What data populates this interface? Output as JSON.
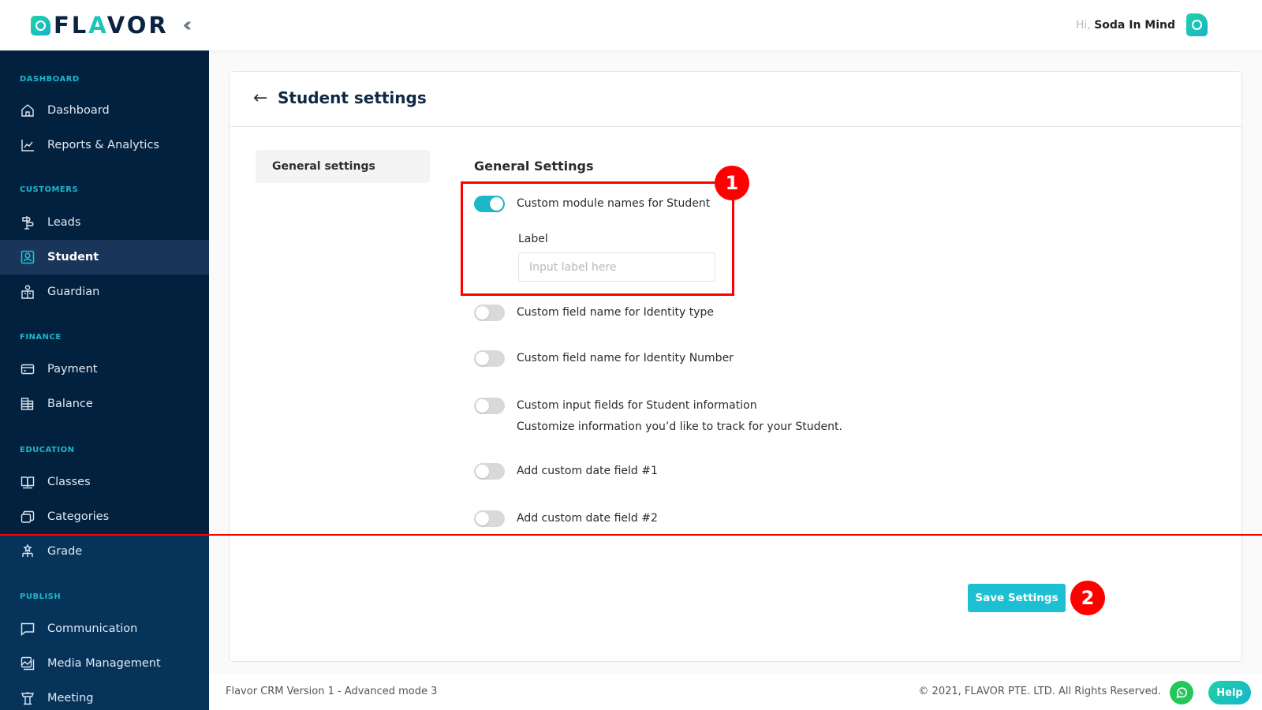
{
  "header": {
    "logo_prefix": "FL",
    "logo_accent": "A",
    "logo_suffix": "VOR",
    "collapse_icon": "double-chevron-left-icon",
    "greeting_prefix": "Hi,",
    "user_name": "Soda In Mind"
  },
  "sidebar": {
    "sections": [
      {
        "label": "DASHBOARD",
        "items": [
          {
            "label": "Dashboard",
            "icon": "home-icon"
          },
          {
            "label": "Reports & Analytics",
            "icon": "chart-line-icon"
          }
        ]
      },
      {
        "label": "CUSTOMERS",
        "items": [
          {
            "label": "Leads",
            "icon": "signpost-icon"
          },
          {
            "label": "Student",
            "icon": "user-square-icon",
            "active": true
          },
          {
            "label": "Guardian",
            "icon": "guardian-icon"
          }
        ]
      },
      {
        "label": "FINANCE",
        "items": [
          {
            "label": "Payment",
            "icon": "credit-card-icon"
          },
          {
            "label": "Balance",
            "icon": "ledger-icon"
          }
        ]
      },
      {
        "label": "EDUCATION",
        "items": [
          {
            "label": "Classes",
            "icon": "book-open-icon"
          },
          {
            "label": "Categories",
            "icon": "layers-icon"
          },
          {
            "label": "Grade",
            "icon": "hierarchy-icon"
          }
        ]
      },
      {
        "label": "PUBLISH",
        "items": [
          {
            "label": "Communication",
            "icon": "message-square-icon"
          },
          {
            "label": "Media Management",
            "icon": "image-gallery-icon"
          },
          {
            "label": "Meeting",
            "icon": "podium-icon"
          }
        ]
      }
    ]
  },
  "page": {
    "title": "Student settings",
    "side_tabs": [
      "General settings"
    ],
    "section_title": "General Settings",
    "settings": [
      {
        "label": "Custom module names for Student",
        "enabled": true
      },
      {
        "label": "Custom field name for Identity type",
        "enabled": false
      },
      {
        "label": "Custom field name for Identity Number",
        "enabled": false
      },
      {
        "label": "Custom input fields for Student information",
        "description": "Customize information you’d like to track for your Student.",
        "enabled": false
      },
      {
        "label": "Add custom date field #1",
        "enabled": false
      },
      {
        "label": "Add custom date field #2",
        "enabled": false
      }
    ],
    "label_field": {
      "label": "Label",
      "placeholder": "Input label here",
      "value": ""
    },
    "save_label": "Save Settings"
  },
  "annotations": {
    "badge_1": "1",
    "badge_2": "2",
    "color": "#ff0000"
  },
  "footer": {
    "version": "Flavor CRM Version 1 - Advanced mode 3",
    "copyright": "© 2021, FLAVOR PTE. LTD. All Rights Reserved.",
    "help_label": "Help"
  },
  "colors": {
    "accent": "#1cc0d2",
    "sidebar_bg": "#02213f",
    "sidebar_section_label": "#1fb5c9",
    "title": "#0e2845"
  }
}
